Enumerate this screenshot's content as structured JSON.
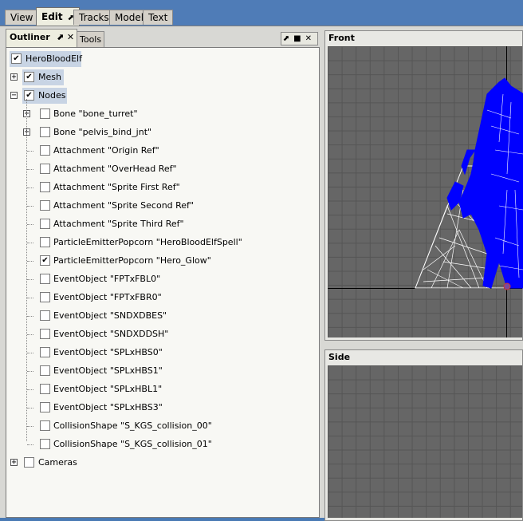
{
  "top_tabs": [
    {
      "label": "View",
      "active": false
    },
    {
      "label": "Edit",
      "active": true
    },
    {
      "label": "Tracks",
      "active": false
    },
    {
      "label": "Model",
      "active": false
    },
    {
      "label": "Text",
      "active": false
    }
  ],
  "panel": {
    "tabs": [
      "Outliner",
      "Tools"
    ],
    "active_tab": "Outliner",
    "ctrl_pin": "⬈",
    "ctrl_close": "✕"
  },
  "tree": {
    "root": {
      "label": "HeroBloodElf",
      "checked": true
    },
    "mesh": {
      "label": "Mesh",
      "checked": true,
      "expander": "+"
    },
    "nodes": {
      "label": "Nodes",
      "checked": true,
      "expander": "−"
    },
    "children": [
      {
        "label": "Bone \"bone_turret\"",
        "checked": false,
        "expander": "+"
      },
      {
        "label": "Bone \"pelvis_bind_jnt\"",
        "checked": false,
        "expander": "+"
      },
      {
        "label": "Attachment \"Origin Ref\"",
        "checked": false
      },
      {
        "label": "Attachment \"OverHead Ref\"",
        "checked": false
      },
      {
        "label": "Attachment \"Sprite First Ref\"",
        "checked": false
      },
      {
        "label": "Attachment \"Sprite Second Ref\"",
        "checked": false
      },
      {
        "label": "Attachment \"Sprite Third Ref\"",
        "checked": false
      },
      {
        "label": "ParticleEmitterPopcorn \"HeroBloodElfSpell\"",
        "checked": false
      },
      {
        "label": "ParticleEmitterPopcorn \"Hero_Glow\"",
        "checked": true
      },
      {
        "label": "EventObject \"FPTxFBL0\"",
        "checked": false
      },
      {
        "label": "EventObject \"FPTxFBR0\"",
        "checked": false
      },
      {
        "label": "EventObject \"SNDXDBES\"",
        "checked": false
      },
      {
        "label": "EventObject \"SNDXDDSH\"",
        "checked": false
      },
      {
        "label": "EventObject \"SPLxHBS0\"",
        "checked": false
      },
      {
        "label": "EventObject \"SPLxHBS1\"",
        "checked": false
      },
      {
        "label": "EventObject \"SPLxHBL1\"",
        "checked": false
      },
      {
        "label": "EventObject \"SPLxHBS3\"",
        "checked": false
      },
      {
        "label": "CollisionShape \"S_KGS_collision_00\"",
        "checked": false
      },
      {
        "label": "CollisionShape \"S_KGS_collision_01\"",
        "checked": false
      }
    ],
    "cameras": {
      "label": "Cameras",
      "checked": false,
      "expander": "+"
    }
  },
  "views": {
    "front": {
      "title": "Front"
    },
    "side": {
      "title": "Side"
    }
  },
  "colors": {
    "mesh_selected": "#0000ff",
    "mesh_wire": "#ffffff",
    "viewport_bg": "#666666",
    "grid": "#555555"
  }
}
